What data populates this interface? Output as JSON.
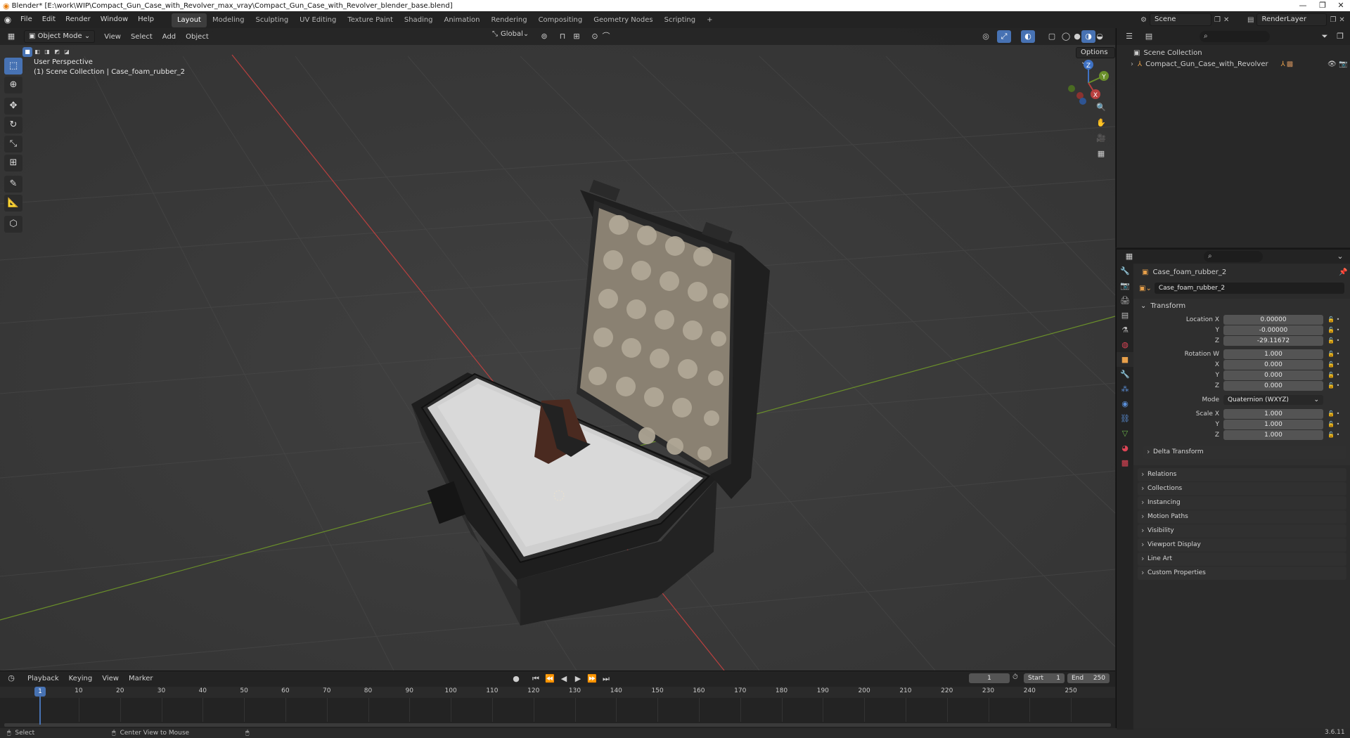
{
  "window": {
    "title": "Blender* [E:\\work\\WIP\\Compact_Gun_Case_with_Revolver_max_vray\\Compact_Gun_Case_with_Revolver_blender_base.blend]",
    "minimize": "—",
    "maximize": "❐",
    "close": "✕"
  },
  "menu": [
    "File",
    "Edit",
    "Render",
    "Window",
    "Help"
  ],
  "workspaces": [
    "Layout",
    "Modeling",
    "Sculpting",
    "UV Editing",
    "Texture Paint",
    "Shading",
    "Animation",
    "Rendering",
    "Compositing",
    "Geometry Nodes",
    "Scripting"
  ],
  "add_workspace": "+",
  "scene": {
    "name": "Scene",
    "render_layer": "RenderLayer"
  },
  "viewport": {
    "mode": "Object Mode",
    "menus": [
      "View",
      "Select",
      "Add",
      "Object"
    ],
    "transform_orientation": "Global",
    "options": "Options",
    "perspective": "User Perspective",
    "collection_info": "(1) Scene Collection | Case_foam_rubber_2",
    "gizmo": {
      "x": "X",
      "y": "Y",
      "z": "Z"
    }
  },
  "outliner": {
    "scene_collection": "Scene Collection",
    "item": "Compact_Gun_Case_with_Revolver"
  },
  "properties": {
    "object_name": "Case_foam_rubber_2",
    "datablock": "Case_foam_rubber_2",
    "transform": {
      "header": "Transform",
      "location_label": "Location X",
      "location": [
        "0.00000",
        "-0.00000",
        "-29.11672"
      ],
      "rotation_label": "Rotation W",
      "rotation": [
        "1.000",
        "0.000",
        "0.000",
        "0.000"
      ],
      "mode_label": "Mode",
      "mode": "Quaternion (WXYZ)",
      "scale_label": "Scale X",
      "scale": [
        "1.000",
        "1.000",
        "1.000"
      ],
      "axis_y": "Y",
      "axis_z": "Z",
      "axis_x": "X"
    },
    "delta_transform": "Delta Transform",
    "panels": [
      "Relations",
      "Collections",
      "Instancing",
      "Motion Paths",
      "Visibility",
      "Viewport Display",
      "Line Art",
      "Custom Properties"
    ]
  },
  "timeline": {
    "menus": [
      "Playback",
      "Keying",
      "View",
      "Marker"
    ],
    "current_frame": "1",
    "start_label": "Start",
    "start": "1",
    "end_label": "End",
    "end": "250",
    "ticks": [
      "1",
      "10",
      "20",
      "30",
      "40",
      "50",
      "60",
      "70",
      "80",
      "90",
      "100",
      "110",
      "120",
      "130",
      "140",
      "150",
      "160",
      "170",
      "180",
      "190",
      "200",
      "210",
      "220",
      "230",
      "240",
      "250"
    ]
  },
  "status": {
    "select": "Select",
    "center_view": "Center View to Mouse",
    "version": "3.6.11"
  },
  "colors": {
    "accent": "#4772b3",
    "x_axis": "#b8403f",
    "y_axis": "#6a8f2a",
    "z_axis": "#3f72c4"
  }
}
